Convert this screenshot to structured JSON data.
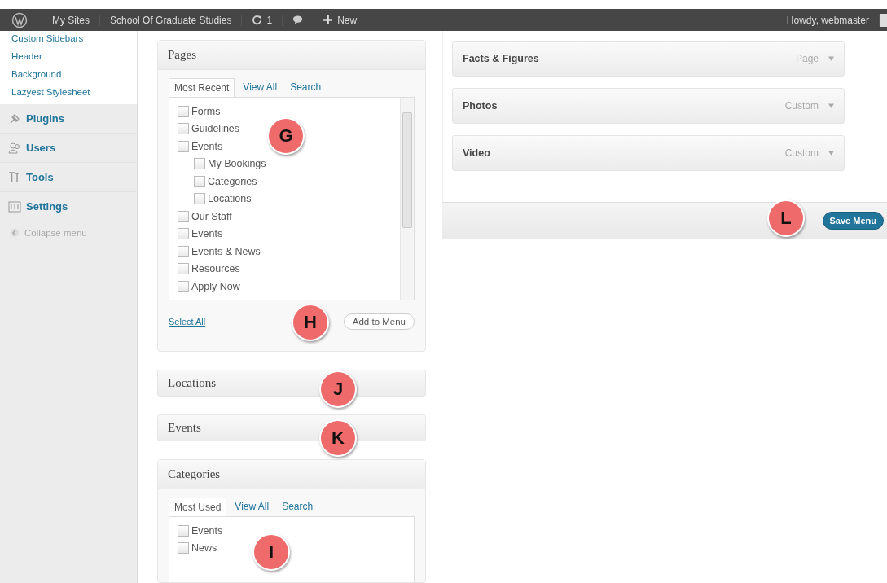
{
  "admin_bar": {
    "site_menu": "My Sites",
    "site_name": "School Of Graduate Studies",
    "updates": "1",
    "new_label": "New",
    "greeting": "Howdy, webmaster"
  },
  "sidebar": {
    "submenu": [
      "Custom Sidebars",
      "Header",
      "Background",
      "Lazyest Stylesheet"
    ],
    "menu": [
      {
        "label": "Plugins",
        "kind": "plugin"
      },
      {
        "label": "Users",
        "kind": "users"
      },
      {
        "label": "Tools",
        "kind": "tools"
      },
      {
        "label": "Settings",
        "kind": "settings"
      }
    ],
    "collapse": "Collapse menu"
  },
  "pages_box": {
    "title": "Pages",
    "tabs": [
      {
        "label": "Most Recent",
        "selected": true
      },
      {
        "label": "View All",
        "selected": false
      },
      {
        "label": "Search",
        "selected": false
      }
    ],
    "items": [
      {
        "label": "Forms",
        "checked": false
      },
      {
        "label": "Guidelines",
        "checked": false
      },
      {
        "label": "Events",
        "checked": false,
        "children": [
          {
            "label": "My Bookings",
            "checked": false
          },
          {
            "label": "Categories",
            "checked": false
          },
          {
            "label": "Locations",
            "checked": false
          }
        ]
      },
      {
        "label": "Our Staff",
        "checked": false
      },
      {
        "label": "Events",
        "checked": false
      },
      {
        "label": "Events & News",
        "checked": false
      },
      {
        "label": "Resources",
        "checked": false
      },
      {
        "label": "Apply Now",
        "checked": false
      }
    ],
    "select_all": "Select All",
    "add_button": "Add to Menu"
  },
  "collapsed_boxes": [
    "Locations",
    "Events"
  ],
  "categories_box": {
    "title": "Categories",
    "tabs": [
      {
        "label": "Most Used",
        "selected": true
      },
      {
        "label": "View All",
        "selected": false
      },
      {
        "label": "Search",
        "selected": false
      }
    ],
    "items": [
      {
        "label": "Events",
        "checked": false
      },
      {
        "label": "News",
        "checked": false
      }
    ]
  },
  "menu_items": [
    {
      "title": "Facts & Figures",
      "type": "Page"
    },
    {
      "title": "Photos",
      "type": "Custom"
    },
    {
      "title": "Video",
      "type": "Custom"
    }
  ],
  "save_button": "Save Menu",
  "callouts": [
    "G",
    "H",
    "J",
    "K",
    "I",
    "L"
  ]
}
